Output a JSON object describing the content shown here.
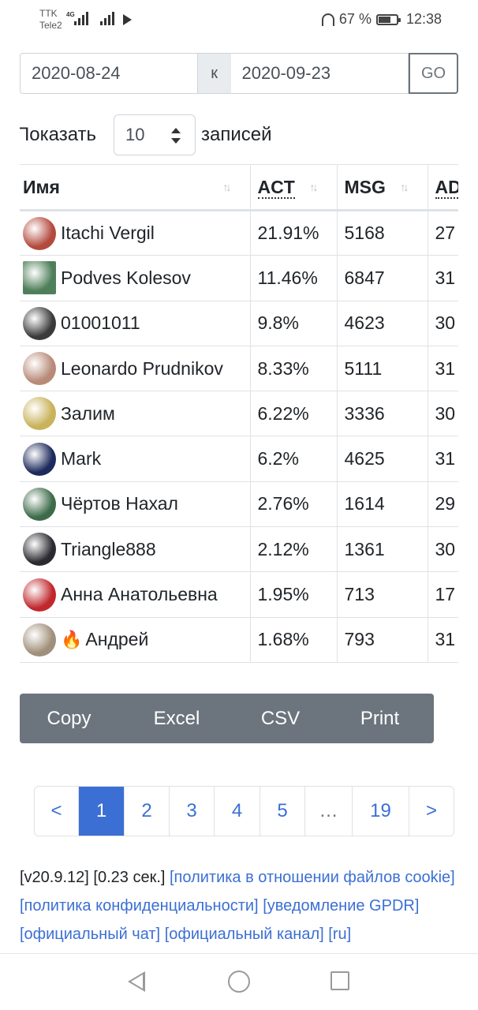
{
  "status_bar": {
    "carrier_1": "TTK",
    "carrier_2": "Tele2",
    "network": "4G",
    "battery_pct": "67 %",
    "time": "12:38"
  },
  "date_range": {
    "from": "2020-08-24",
    "separator": "к",
    "to": "2020-09-23",
    "go_label": "GO"
  },
  "entries": {
    "show_label": "Показать",
    "page_size": "10",
    "records_label": "записей"
  },
  "table": {
    "columns": [
      "Имя",
      "ACT",
      "MSG",
      "AD"
    ],
    "sort_icon": "sort-arrows-icon",
    "rows": [
      {
        "name": "Itachi Vergil",
        "act": "21.91%",
        "msg": "5168",
        "ad": "27",
        "avatar_color": "#b34a3e"
      },
      {
        "name": "Podves Kolesov",
        "act": "11.46%",
        "msg": "6847",
        "ad": "31",
        "avatar_color": "#4f7f5a"
      },
      {
        "name": "01001011",
        "act": "9.8%",
        "msg": "4623",
        "ad": "30",
        "avatar_color": "#3a3a3a"
      },
      {
        "name": "Leonardo Prudnikov",
        "act": "8.33%",
        "msg": "5111",
        "ad": "31",
        "avatar_color": "#b88a78"
      },
      {
        "name": "Залим",
        "act": "6.22%",
        "msg": "3336",
        "ad": "30",
        "avatar_color": "#c9b25a"
      },
      {
        "name": "Mark",
        "act": "6.2%",
        "msg": "4625",
        "ad": "31",
        "avatar_color": "#1d2a5c"
      },
      {
        "name": "Чёртов Нахал",
        "act": "2.76%",
        "msg": "1614",
        "ad": "29",
        "avatar_color": "#3d6b4a"
      },
      {
        "name": "Triangle888",
        "act": "2.12%",
        "msg": "1361",
        "ad": "30",
        "avatar_color": "#2a2a30"
      },
      {
        "name": "Анна Анатольевна",
        "act": "1.95%",
        "msg": "713",
        "ad": "17",
        "avatar_color": "#c0282d"
      },
      {
        "name": "Андрей",
        "act": "1.68%",
        "msg": "793",
        "ad": "31",
        "avatar_color": "#a08f7a",
        "prefix": "🔥"
      }
    ]
  },
  "buttons": [
    "Copy",
    "Excel",
    "CSV",
    "Print"
  ],
  "pagination": {
    "prev": "<",
    "pages": [
      "1",
      "2",
      "3",
      "4",
      "5",
      "…",
      "19"
    ],
    "next": ">",
    "active": "1"
  },
  "footer": {
    "version": "[v20.9.12]",
    "timing": "[0.23 сек.]",
    "links": [
      "[политика в отношении файлов cookie]",
      "[политика конфиденциальности]",
      "[уведомление GPDR]",
      "[официальный чат]",
      "[официальный канал]",
      "[ru]"
    ]
  },
  "colors": {
    "accent": "#3b6fd4",
    "button_group": "#6c757d"
  }
}
